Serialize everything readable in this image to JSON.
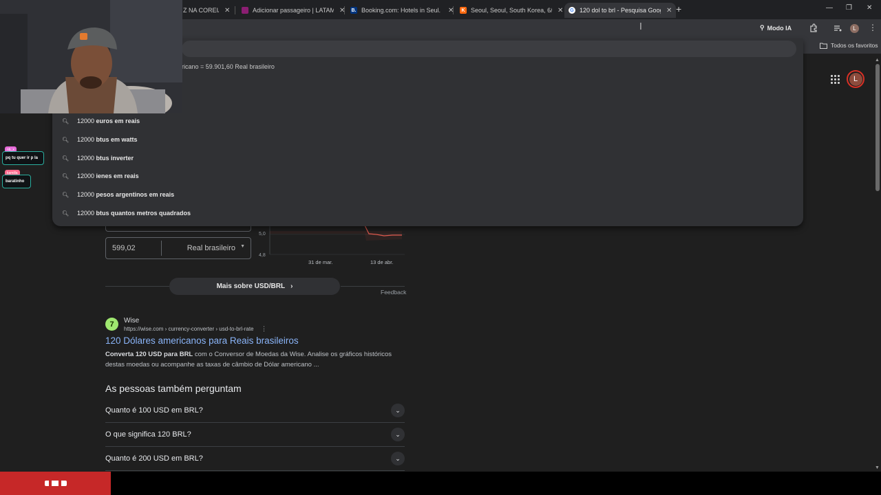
{
  "browser": {
    "tabs": [
      {
        "title": "Z NA COREIA D",
        "icon": "twitch-favicon",
        "color": "#9146ff"
      },
      {
        "title": "Adicionar passageiro | LATAM A",
        "icon": "latam-favicon",
        "color": "#8b1e72"
      },
      {
        "title": "Booking.com: Hotels in Seul. Re",
        "icon": "booking-favicon",
        "color": "#003580",
        "letter": "B."
      },
      {
        "title": "Seoul, Seoul, South Korea, 6/17",
        "icon": "kayak-favicon",
        "color": "#ff690f",
        "letter": "K"
      },
      {
        "title": "120 dol to brl - Pesquisa Googl",
        "icon": "google-favicon",
        "color": "#ffffff",
        "letter": "G"
      }
    ],
    "new_tab": "+",
    "window_controls": {
      "minimize": "—",
      "restore": "❐",
      "close": "✕"
    },
    "modo_ia": "Modo IA",
    "profile_letter": "L",
    "bookmarks_all": "Todos os favoritos"
  },
  "omnibox": {
    "answer_text": "ricano = 59.901,60 Real brasileiro",
    "suggestions": [
      {
        "prefix": "12000",
        "rest": "euros em reais"
      },
      {
        "prefix": "12000",
        "rest": "btus em watts"
      },
      {
        "prefix": "12000",
        "rest": "btus inverter"
      },
      {
        "prefix": "12000",
        "rest": "ienes em reais"
      },
      {
        "prefix": "12000",
        "rest": "pesos argentinos em reais"
      },
      {
        "prefix": "12000",
        "rest": "btus quantos metros quadrados"
      }
    ]
  },
  "converter": {
    "target_value": "599,02",
    "target_currency": "Real brasileiro",
    "chart_y_ticks": [
      "5,0",
      "4,8"
    ],
    "chart_x_ticks": [
      "31 de mar.",
      "13 de abr."
    ],
    "more_button": "Mais sobre USD/BRL",
    "feedback": "Feedback"
  },
  "result": {
    "site": "Wise",
    "url": "https://wise.com › currency-converter › usd-to-brl-rate",
    "title": "120 Dólares americanos para Reais brasileiros",
    "snippet_bold": "Converta 120 USD para BRL",
    "snippet_rest": " com o Conversor de Moedas da Wise. Analise os gráficos históricos destas moedas ou acompanhe as taxas de câmbio de Dólar americano ..."
  },
  "paa": {
    "heading": "As pessoas também perguntam",
    "questions": [
      "Quanto é 100 USD em BRL?",
      "O que significa 120 BRL?",
      "Quanto é 200 USD em BRL?"
    ]
  },
  "chat": [
    {
      "tag": "nb_x",
      "message": "pq tu quer ir p la",
      "tag_color": "#e66bd8"
    },
    {
      "tag": "kamilla",
      "message": "baratinho",
      "tag_color": "#ff6a8e"
    }
  ]
}
